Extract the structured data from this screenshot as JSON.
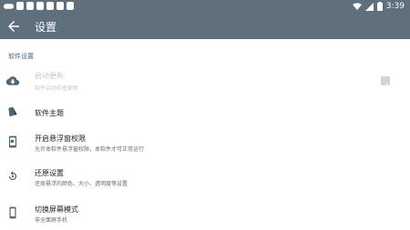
{
  "status": {
    "time": "3:39"
  },
  "appbar": {
    "title": "设置"
  },
  "section": {
    "title": "软件设置"
  },
  "rows": [
    {
      "title": "启动更新",
      "subtitle": "软件启动检查更新",
      "icon": "cloud-download-icon",
      "enabled": false,
      "checked": true
    },
    {
      "title": "软件主题",
      "subtitle": "",
      "icon": "palette-icon"
    },
    {
      "title": "开启悬浮窗权限",
      "subtitle": "允许本软件悬浮窗权限，本软件才可正常运行",
      "icon": "floating-window-icon"
    },
    {
      "title": "还原设置",
      "subtitle": "还原悬浮的颜色、大小、透明度等设置",
      "icon": "restore-icon"
    },
    {
      "title": "切换屏幕模式",
      "subtitle": "非全面屏手机",
      "icon": "phone-icon"
    }
  ],
  "colors": {
    "appbar": "#5f6f7c",
    "section_text": "#4e6373",
    "icon": "#4e6373"
  }
}
